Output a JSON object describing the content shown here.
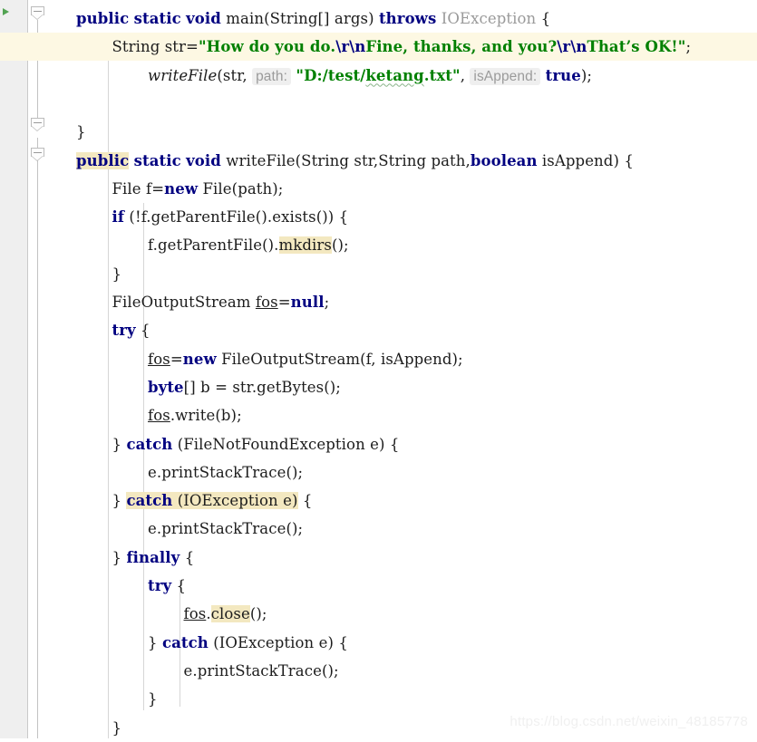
{
  "editor": {
    "language": "Java",
    "background": "#ffffff",
    "gutter_color": "#efefef",
    "current_line_background": "#fdf8e3",
    "occurrence_highlight_color": "#f3e8c0",
    "keyword_color": "#000080",
    "string_color": "#008000",
    "hint_text_color": "#9b9b9b",
    "spellcheck_underline_color": "#8ab48a"
  },
  "markers": {
    "run_gutter_icon": "green-run-arrow",
    "fold_icons": [
      "fold-collapse-icon",
      "fold-collapse-icon",
      "fold-collapse-icon"
    ]
  },
  "code": {
    "lines": [
      {
        "indent": 0,
        "highlighted": false,
        "tokens": [
          {
            "t": "public",
            "c": "kw"
          },
          {
            "t": " ",
            "c": "plain"
          },
          {
            "t": "static",
            "c": "kw"
          },
          {
            "t": " ",
            "c": "plain"
          },
          {
            "t": "void",
            "c": "kw"
          },
          {
            "t": " main(String[] args) ",
            "c": "plain"
          },
          {
            "t": "throws",
            "c": "kw"
          },
          {
            "t": " ",
            "c": "plain"
          },
          {
            "t": "IOException",
            "c": "gray"
          },
          {
            "t": " {",
            "c": "plain"
          }
        ]
      },
      {
        "indent": 1,
        "highlighted": true,
        "tokens": [
          {
            "t": "String str=",
            "c": "plain"
          },
          {
            "t": "\"How do you do.",
            "c": "str"
          },
          {
            "t": "\\r\\n",
            "c": "esc"
          },
          {
            "t": "Fine, thanks, and you?",
            "c": "str"
          },
          {
            "t": "\\r\\n",
            "c": "esc"
          },
          {
            "t": "That’s OK!\"",
            "c": "str"
          },
          {
            "t": ";",
            "c": "plain"
          }
        ]
      },
      {
        "indent": 2,
        "highlighted": false,
        "tokens": [
          {
            "t": "writeFile",
            "c": "ital"
          },
          {
            "t": "(str, ",
            "c": "plain"
          },
          {
            "t": "path:",
            "c": "hint"
          },
          {
            "t": " ",
            "c": "plain"
          },
          {
            "t": "\"D:/test/",
            "c": "str"
          },
          {
            "t": "ketang",
            "c": "str wavy"
          },
          {
            "t": ".txt\"",
            "c": "str"
          },
          {
            "t": ", ",
            "c": "plain"
          },
          {
            "t": "isAppend:",
            "c": "hint"
          },
          {
            "t": " ",
            "c": "plain"
          },
          {
            "t": "true",
            "c": "kw"
          },
          {
            "t": ");",
            "c": "plain"
          }
        ]
      },
      {
        "indent": 0,
        "highlighted": false,
        "blank": true,
        "tokens": []
      },
      {
        "indent": 0,
        "highlighted": false,
        "tokens": [
          {
            "t": "}",
            "c": "plain"
          }
        ]
      },
      {
        "indent": 0,
        "highlighted": false,
        "tokens": [
          {
            "t": "public",
            "c": "kw occ"
          },
          {
            "t": " ",
            "c": "plain"
          },
          {
            "t": "static",
            "c": "kw"
          },
          {
            "t": " ",
            "c": "plain"
          },
          {
            "t": "void",
            "c": "kw"
          },
          {
            "t": " writeFile(String str,String path,",
            "c": "plain"
          },
          {
            "t": "boolean",
            "c": "kw"
          },
          {
            "t": " isAppend) {",
            "c": "plain"
          }
        ]
      },
      {
        "indent": 1,
        "highlighted": false,
        "tokens": [
          {
            "t": "File f=",
            "c": "plain"
          },
          {
            "t": "new",
            "c": "kw"
          },
          {
            "t": " File(path);",
            "c": "plain"
          }
        ]
      },
      {
        "indent": 1,
        "highlighted": false,
        "tokens": [
          {
            "t": "if",
            "c": "kw"
          },
          {
            "t": " (!f.getParentFile().exists()) {",
            "c": "plain"
          }
        ]
      },
      {
        "indent": 2,
        "highlighted": false,
        "tokens": [
          {
            "t": "f.getParentFile().",
            "c": "plain"
          },
          {
            "t": "mkdirs",
            "c": "plain occ"
          },
          {
            "t": "();",
            "c": "plain"
          }
        ]
      },
      {
        "indent": 1,
        "highlighted": false,
        "tokens": [
          {
            "t": "}",
            "c": "plain"
          }
        ]
      },
      {
        "indent": 1,
        "highlighted": false,
        "tokens": [
          {
            "t": "FileOutputStream ",
            "c": "plain"
          },
          {
            "t": "fos",
            "c": "fieldu"
          },
          {
            "t": "=",
            "c": "plain"
          },
          {
            "t": "null",
            "c": "kw"
          },
          {
            "t": ";",
            "c": "plain"
          }
        ]
      },
      {
        "indent": 1,
        "highlighted": false,
        "tokens": [
          {
            "t": "try",
            "c": "kw"
          },
          {
            "t": " {",
            "c": "plain"
          }
        ]
      },
      {
        "indent": 2,
        "highlighted": false,
        "tokens": [
          {
            "t": "fos",
            "c": "fieldu"
          },
          {
            "t": "=",
            "c": "plain"
          },
          {
            "t": "new",
            "c": "kw"
          },
          {
            "t": " FileOutputStream(f, isAppend);",
            "c": "plain"
          }
        ]
      },
      {
        "indent": 2,
        "highlighted": false,
        "tokens": [
          {
            "t": "byte",
            "c": "kw"
          },
          {
            "t": "[] b = str.getBytes();",
            "c": "plain"
          }
        ]
      },
      {
        "indent": 2,
        "highlighted": false,
        "tokens": [
          {
            "t": "fos",
            "c": "fieldu"
          },
          {
            "t": ".write(b);",
            "c": "plain"
          }
        ]
      },
      {
        "indent": 1,
        "highlighted": false,
        "tokens": [
          {
            "t": "} ",
            "c": "plain"
          },
          {
            "t": "catch",
            "c": "kw"
          },
          {
            "t": " (FileNotFoundException e) {",
            "c": "plain"
          }
        ]
      },
      {
        "indent": 2,
        "highlighted": false,
        "tokens": [
          {
            "t": "e.printStackTrace();",
            "c": "plain"
          }
        ]
      },
      {
        "indent": 1,
        "highlighted": false,
        "tokens": [
          {
            "t": "} ",
            "c": "plain"
          },
          {
            "t": "catch",
            "c": "kw occ"
          },
          {
            "t": " (IOException e)",
            "c": "plain occ"
          },
          {
            "t": " {",
            "c": "plain"
          }
        ]
      },
      {
        "indent": 2,
        "highlighted": false,
        "tokens": [
          {
            "t": "e.printStackTrace();",
            "c": "plain"
          }
        ]
      },
      {
        "indent": 1,
        "highlighted": false,
        "tokens": [
          {
            "t": "} ",
            "c": "plain"
          },
          {
            "t": "finally",
            "c": "kw"
          },
          {
            "t": " {",
            "c": "plain"
          }
        ]
      },
      {
        "indent": 2,
        "highlighted": false,
        "tokens": [
          {
            "t": "try",
            "c": "kw"
          },
          {
            "t": " {",
            "c": "plain"
          }
        ]
      },
      {
        "indent": 3,
        "highlighted": false,
        "tokens": [
          {
            "t": "fos",
            "c": "fieldu"
          },
          {
            "t": ".",
            "c": "plain"
          },
          {
            "t": "close",
            "c": "plain occ"
          },
          {
            "t": "();",
            "c": "plain"
          }
        ]
      },
      {
        "indent": 2,
        "highlighted": false,
        "tokens": [
          {
            "t": "} ",
            "c": "plain"
          },
          {
            "t": "catch",
            "c": "kw"
          },
          {
            "t": " (IOException e) {",
            "c": "plain"
          }
        ]
      },
      {
        "indent": 3,
        "highlighted": false,
        "tokens": [
          {
            "t": "e.printStackTrace();",
            "c": "plain"
          }
        ]
      },
      {
        "indent": 2,
        "highlighted": false,
        "tokens": [
          {
            "t": "}",
            "c": "plain"
          }
        ]
      },
      {
        "indent": 1,
        "highlighted": false,
        "tokens": [
          {
            "t": "}",
            "c": "plain"
          }
        ]
      }
    ]
  },
  "watermark": {
    "text": "https://blog.csdn.net/weixin_48185778"
  }
}
